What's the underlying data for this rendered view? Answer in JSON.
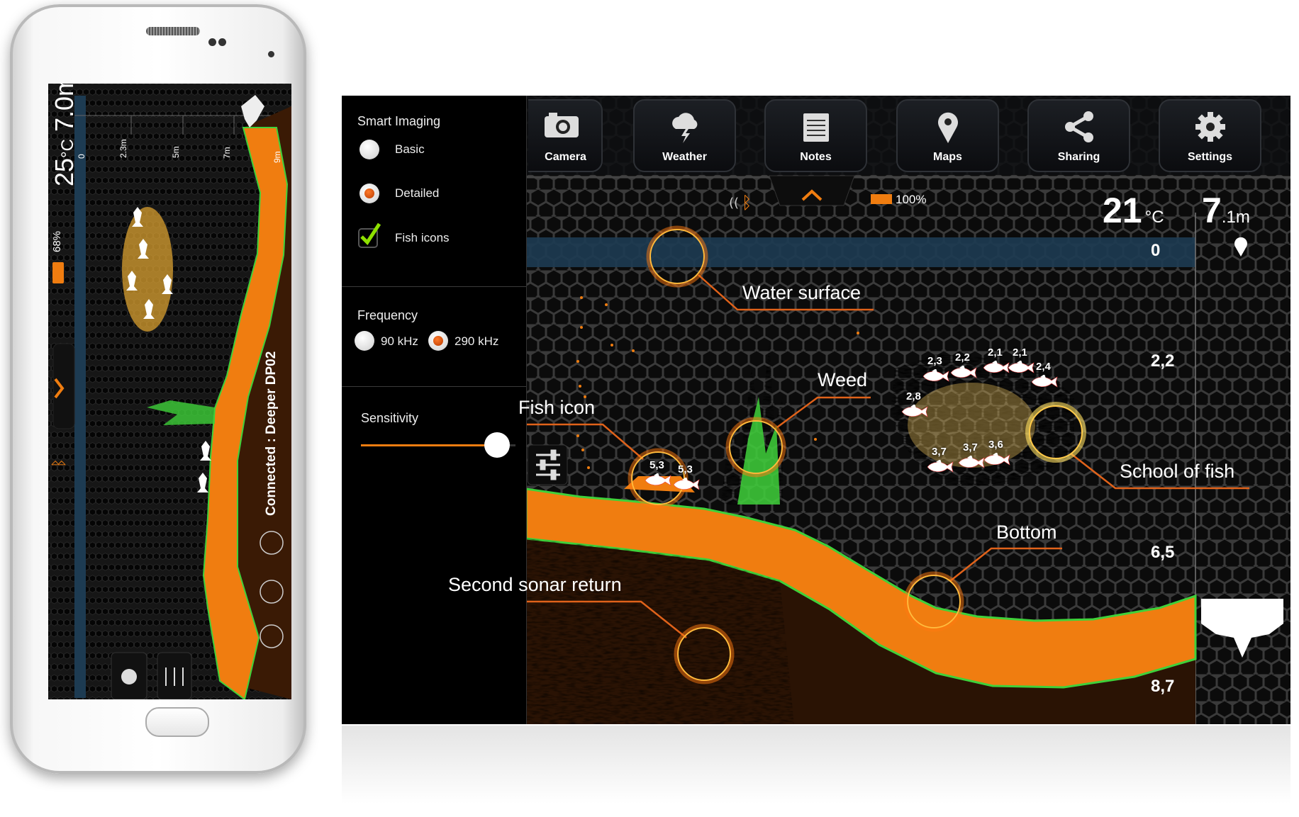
{
  "phone": {
    "temperature": "25",
    "temp_unit": "°C",
    "depth": "7.0m",
    "battery": "68%",
    "depth_ticks": [
      "0",
      "2.3m",
      "5m",
      "7m",
      "9m"
    ],
    "connection": "Connected : Deeper DP02"
  },
  "settings": {
    "smart_imaging": {
      "title": "Smart Imaging",
      "options": [
        {
          "label": "Basic",
          "selected": false
        },
        {
          "label": "Detailed",
          "selected": true
        }
      ],
      "fish_icons": {
        "label": "Fish icons",
        "checked": true
      }
    },
    "frequency": {
      "title": "Frequency",
      "options": [
        {
          "label": "90 kHz",
          "selected": false
        },
        {
          "label": "290 kHz",
          "selected": true
        }
      ]
    },
    "sensitivity": {
      "title": "Sensitivity",
      "value": 0.88
    }
  },
  "toolbar": [
    {
      "label": "Camera",
      "icon": "camera-icon"
    },
    {
      "label": "Weather",
      "icon": "weather-icon"
    },
    {
      "label": "Notes",
      "icon": "notes-icon"
    },
    {
      "label": "Maps",
      "icon": "map-pin-icon"
    },
    {
      "label": "Sharing",
      "icon": "share-icon"
    },
    {
      "label": "Settings",
      "icon": "gear-icon"
    }
  ],
  "status": {
    "battery": "100%",
    "temperature": "21",
    "temp_unit": "°C",
    "depth": "7",
    "depth_unit": ".1m"
  },
  "depth_scale": [
    "0",
    "2,2",
    "6,5",
    "8,7"
  ],
  "callouts": {
    "water_surface": "Water surface",
    "weed": "Weed",
    "fish_icon": "Fish icon",
    "school_of_fish": "School of fish",
    "bottom": "Bottom",
    "second_sonar_return": "Second sonar return"
  },
  "fish": [
    "2,3",
    "2,2",
    "2,1",
    "2,1",
    "2,4",
    "2,8",
    "3,7",
    "3,7",
    "3,6",
    "5,3",
    "5,3"
  ],
  "colors": {
    "accent": "#f07d10",
    "weed": "#3fd13a",
    "water": "#1d3b52",
    "selected_radio": "#c8430a"
  }
}
